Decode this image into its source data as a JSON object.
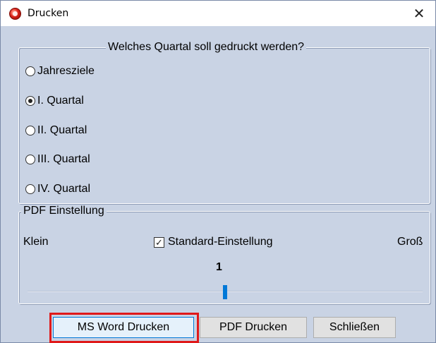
{
  "window": {
    "title": "Drucken",
    "close_glyph": "✕"
  },
  "quartal_group": {
    "legend": "Welches Quartal soll gedruckt werden?",
    "options": [
      {
        "label": "Jahresziele",
        "checked": false
      },
      {
        "label": "I. Quartal",
        "checked": true
      },
      {
        "label": "II. Quartal",
        "checked": false
      },
      {
        "label": "III. Quartal",
        "checked": false
      },
      {
        "label": "IV. Quartal",
        "checked": false
      }
    ]
  },
  "pdf_group": {
    "legend": "PDF Einstellung",
    "min_label": "Klein",
    "max_label": "Groß",
    "standard_checkbox": {
      "label": "Standard-Einstellung",
      "checked": true,
      "glyph": "✓"
    },
    "slider_value": "1"
  },
  "buttons": {
    "word": "MS Word Drucken",
    "pdf": "PDF Drucken",
    "close": "Schließen"
  },
  "colors": {
    "window_bg": "#c9d3e4",
    "highlight_border": "#e0191a",
    "slider_thumb": "#0078d7"
  }
}
